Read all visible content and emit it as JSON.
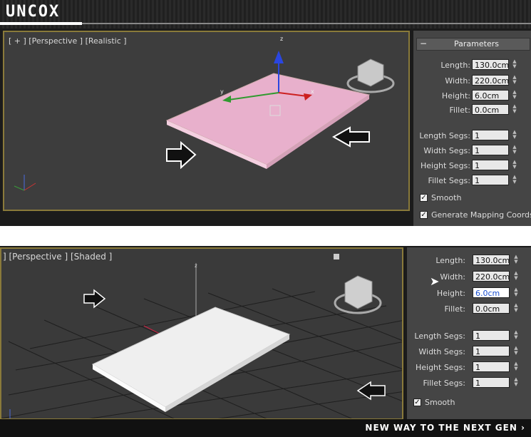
{
  "brand": {
    "logo": "UNCOX",
    "tagline": "NEW WAY TO THE NEXT GEN ›"
  },
  "colors": {
    "viewport_border": "#8a7a3a",
    "box_pink": "#e8a8c8",
    "box_white": "#f0f0f0"
  },
  "top": {
    "viewport_label": "[ + ] [Perspective ] [Realistic ]",
    "axis_z_label": "z",
    "axis_x_label": "x",
    "panel_title": "Parameters",
    "params": [
      {
        "label": "Length:",
        "value": "130.0cm"
      },
      {
        "label": "Width:",
        "value": "220.0cm"
      },
      {
        "label": "Height:",
        "value": "6.0cm"
      },
      {
        "label": "Fillet:",
        "value": "0.0cm"
      }
    ],
    "segs": [
      {
        "label": "Length Segs:",
        "value": "1"
      },
      {
        "label": "Width Segs:",
        "value": "1"
      },
      {
        "label": "Height Segs:",
        "value": "1"
      },
      {
        "label": "Fillet Segs:",
        "value": "1"
      }
    ],
    "smooth_label": "Smooth",
    "mapping_label": "Generate Mapping Coords."
  },
  "bottom": {
    "viewport_label": "] [Perspective ] [Shaded ]",
    "params": [
      {
        "label": "Length:",
        "value": "130.0cm"
      },
      {
        "label": "Width:",
        "value": "220.0cm"
      },
      {
        "label": "Height:",
        "value": "6.0cm"
      },
      {
        "label": "Fillet:",
        "value": "0.0cm"
      }
    ],
    "segs": [
      {
        "label": "Length Segs:",
        "value": "1"
      },
      {
        "label": "Width Segs:",
        "value": "1"
      },
      {
        "label": "Height Segs:",
        "value": "1"
      },
      {
        "label": "Fillet Segs:",
        "value": "1"
      }
    ],
    "smooth_label": "Smooth"
  },
  "icons": [
    "view-cube-icon",
    "arrow-right-icon",
    "arrow-left-icon",
    "axis-tripod-icon",
    "mouse-cursor-icon",
    "minus-icon"
  ]
}
